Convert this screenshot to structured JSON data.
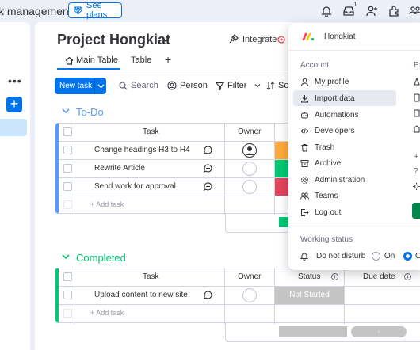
{
  "topbar": {
    "app_title": "k management",
    "see_plans_label": "See plans",
    "notification_count": "1"
  },
  "board": {
    "title": "Project Hongkiat",
    "integrate_label": "Integrate",
    "tabs": [
      {
        "label": "Main Table"
      },
      {
        "label": "Table"
      }
    ],
    "toolbar": {
      "new_task_label": "New task",
      "search_label": "Search",
      "person_label": "Person",
      "filter_label": "Filter",
      "sort_label": "Sor"
    }
  },
  "groups": [
    {
      "title": "To-Do",
      "color": "#579bfc",
      "headers": {
        "task": "Task",
        "owner": "Owner"
      },
      "rows": [
        {
          "task": "Change headings H3 to H4",
          "status_color": "#fdab3d"
        },
        {
          "task": "Rewrite Article",
          "status_color": "#00c875"
        },
        {
          "task": "Send work for approval",
          "status_color": "#e2445c"
        }
      ],
      "add_task_label": "+ Add task"
    },
    {
      "title": "Completed",
      "color": "#00c875",
      "headers": {
        "task": "Task",
        "owner": "Owner",
        "status": "Status",
        "due_date": "Due date"
      },
      "rows": [
        {
          "task": "Upload content to new site",
          "status": "Not Started",
          "status_color": "#c4c4c4"
        }
      ],
      "add_task_label": "+ Add task"
    }
  ],
  "account_menu": {
    "workspace_name": "Hongkiat",
    "section_account": "Account",
    "section_explore_partial": "Ex",
    "items": [
      {
        "label": "My profile",
        "icon": "person-icon"
      },
      {
        "label": "Import data",
        "icon": "download-icon"
      },
      {
        "label": "Automations",
        "icon": "robot-icon"
      },
      {
        "label": "Developers",
        "icon": "code-icon"
      },
      {
        "label": "Trash",
        "icon": "trash-icon"
      },
      {
        "label": "Archive",
        "icon": "archive-icon"
      },
      {
        "label": "Administration",
        "icon": "gear-icon"
      },
      {
        "label": "Teams",
        "icon": "teams-icon"
      },
      {
        "label": "Log out",
        "icon": "logout-icon"
      }
    ],
    "working_status_label": "Working status",
    "do_not_disturb_label": "Do not disturb",
    "on_label": "On",
    "off_label_partial": "O"
  },
  "colors": {
    "primary": "#0073ea",
    "todo_group": "#579bfc",
    "completed_group": "#00c875"
  }
}
